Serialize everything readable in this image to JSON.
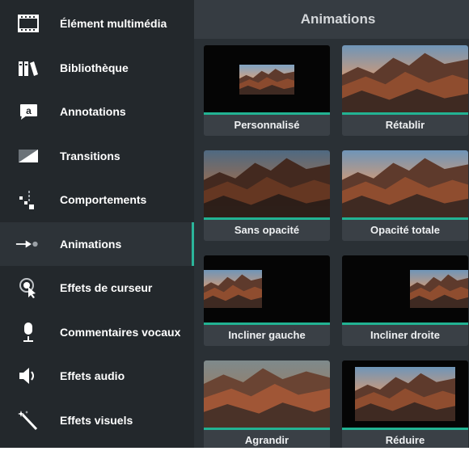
{
  "sidebar": {
    "items": [
      {
        "label": "Élément multimédia",
        "icon": "film-strip-icon"
      },
      {
        "label": "Bibliothèque",
        "icon": "library-books-icon"
      },
      {
        "label": "Annotations",
        "icon": "callout-icon"
      },
      {
        "label": "Transitions",
        "icon": "transition-icon"
      },
      {
        "label": "Comportements",
        "icon": "behaviors-icon"
      },
      {
        "label": "Animations",
        "icon": "animation-arrow-icon",
        "active": true
      },
      {
        "label": "Effets de curseur",
        "icon": "cursor-effects-icon"
      },
      {
        "label": "Commentaires vocaux",
        "icon": "microphone-icon"
      },
      {
        "label": "Effets audio",
        "icon": "speaker-icon"
      },
      {
        "label": "Effets visuels",
        "icon": "magic-wand-icon"
      }
    ]
  },
  "panel": {
    "title": "Animations"
  },
  "animations": [
    {
      "label": "Personnalisé"
    },
    {
      "label": "Rétablir"
    },
    {
      "label": "Sans opacité"
    },
    {
      "label": "Opacité totale"
    },
    {
      "label": "Incliner gauche"
    },
    {
      "label": "Incliner droite"
    },
    {
      "label": "Agrandir"
    },
    {
      "label": "Réduire"
    }
  ],
  "colors": {
    "accent": "#2bb59a",
    "sidebar_bg": "#23282c",
    "panel_bg": "#2a3035",
    "tile_bg": "#3a4046"
  }
}
